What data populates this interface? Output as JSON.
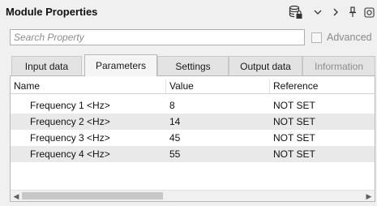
{
  "title": "Module Properties",
  "search": {
    "placeholder": "Search Property"
  },
  "advanced": {
    "label": "Advanced",
    "checked": false,
    "enabled": false
  },
  "tabs": [
    {
      "label": "Input data",
      "active": false,
      "enabled": true
    },
    {
      "label": "Parameters",
      "active": true,
      "enabled": true
    },
    {
      "label": "Settings",
      "active": false,
      "enabled": true
    },
    {
      "label": "Output data",
      "active": false,
      "enabled": true
    },
    {
      "label": "Information",
      "active": false,
      "enabled": false
    }
  ],
  "table": {
    "headers": [
      "Name",
      "Value",
      "Reference"
    ],
    "rows": [
      {
        "name": "Frequency 1 <Hz>",
        "value": "8",
        "reference": "NOT SET"
      },
      {
        "name": "Frequency 2 <Hz>",
        "value": "14",
        "reference": "NOT SET"
      },
      {
        "name": "Frequency 3 <Hz>",
        "value": "45",
        "reference": "NOT SET"
      },
      {
        "name": "Frequency 4 <Hz>",
        "value": "55",
        "reference": "NOT SET"
      }
    ]
  },
  "toolbar_icons": [
    "database-lock-icon",
    "chevron-down-icon",
    "chevron-right-icon",
    "pin-icon",
    "popout-icon"
  ]
}
